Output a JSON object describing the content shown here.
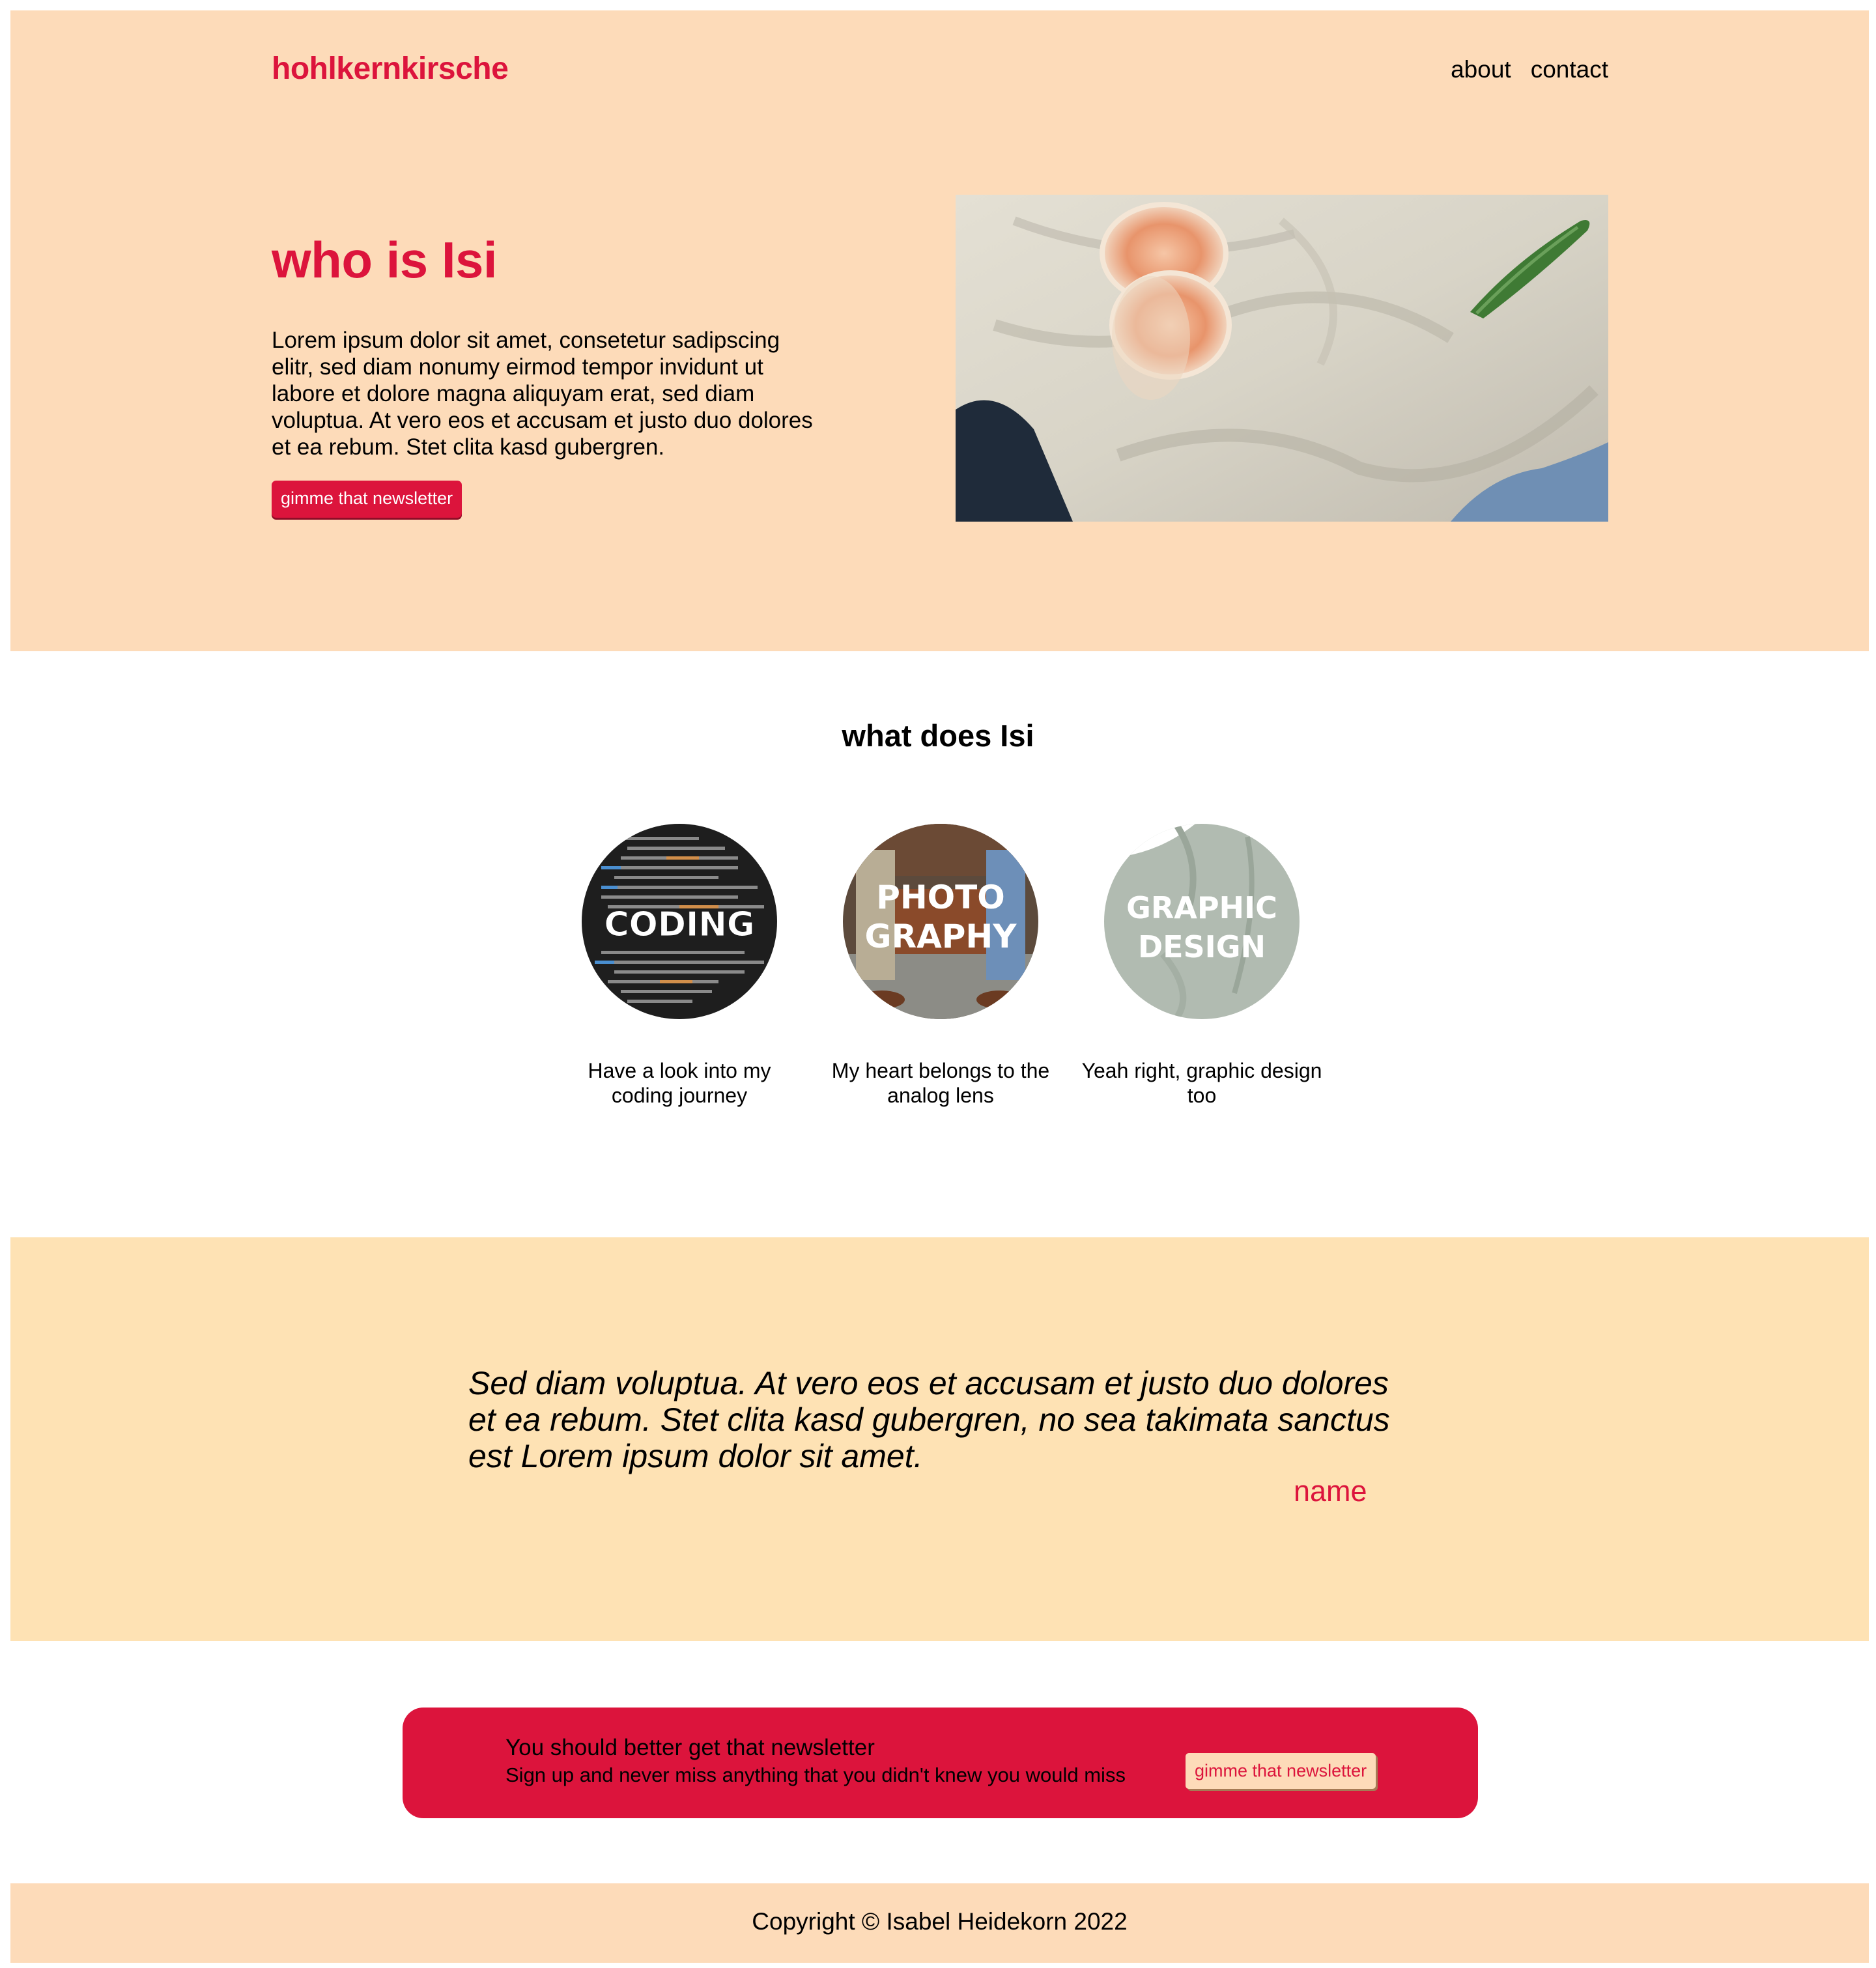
{
  "header": {
    "logo": "hohlkernkirsche",
    "nav": [
      "about",
      "contact"
    ]
  },
  "hero": {
    "title": "who is Isi",
    "text": "Lorem ipsum dolor sit amet, consetetur sadipscing elitr, sed diam nonumy eirmod tempor invidunt ut labore et dolore magna aliquyam erat, sed diam voluptua. At vero eos et accusam et justo duo dolores et ea rebum. Stet clita kasd gubergren.",
    "button_label": "gimme that newsletter"
  },
  "services": {
    "title": "what does Isi",
    "cards": [
      {
        "image_text": [
          "CODING"
        ],
        "caption": "Have a look into my coding journey"
      },
      {
        "image_text": [
          "PHOTO",
          "GRAPHY"
        ],
        "caption": "My heart belongs to the analog lens"
      },
      {
        "image_text": [
          "GRAPHIC",
          "DESIGN"
        ],
        "caption": "Yeah right, graphic design too"
      }
    ]
  },
  "quote": {
    "text": "Sed diam voluptua. At vero eos et accusam et justo duo dolores et ea rebum. Stet clita kasd gubergren, no sea takimata sanctus est Lorem ipsum dolor sit amet.",
    "name": "name"
  },
  "newsletter": {
    "title": "You should better get that newsletter",
    "subtitle": "Sign up and never miss anything that you didn't knew you would miss",
    "button_label": "gimme that newsletter"
  },
  "footer": {
    "copyright": "Copyright © Isabel Heidekorn 2022"
  },
  "colors": {
    "accent": "#dc143c",
    "peach": "#fddbb9",
    "cream": "#fee2b4"
  }
}
